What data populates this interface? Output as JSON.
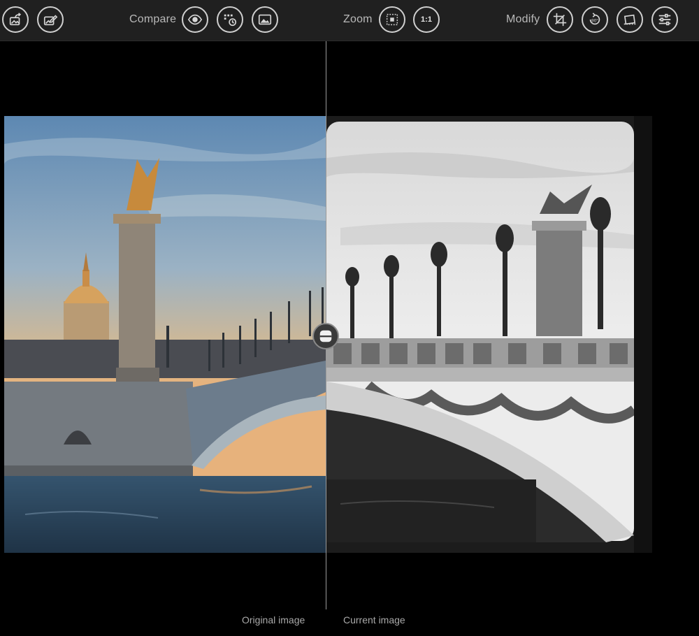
{
  "toolbar": {
    "left_buttons": [
      {
        "icon": "image-export-icon"
      },
      {
        "icon": "image-edit-icon"
      }
    ],
    "compare": {
      "label": "Compare",
      "buttons": [
        {
          "icon": "eye-icon"
        },
        {
          "icon": "history-compare-icon"
        },
        {
          "icon": "image-icon"
        }
      ]
    },
    "zoom": {
      "label": "Zoom",
      "buttons": [
        {
          "icon": "zoom-fit-icon"
        },
        {
          "icon": "zoom-actual-size-icon",
          "text": "1:1"
        }
      ]
    },
    "modify": {
      "label": "Modify",
      "buttons": [
        {
          "icon": "crop-icon"
        },
        {
          "icon": "rotate-90-icon",
          "text": "90°"
        },
        {
          "icon": "straighten-icon"
        },
        {
          "icon": "adjustments-sliders-icon"
        }
      ]
    }
  },
  "viewer": {
    "original_caption": "Original image",
    "current_caption": "Current image",
    "split_handle_icon": "split-view-handle-icon"
  },
  "colors": {
    "toolbar_bg": "#202020",
    "toolbar_icon": "#cfcfcf",
    "viewer_bg": "#000000",
    "label_text": "#b9b9b9"
  }
}
